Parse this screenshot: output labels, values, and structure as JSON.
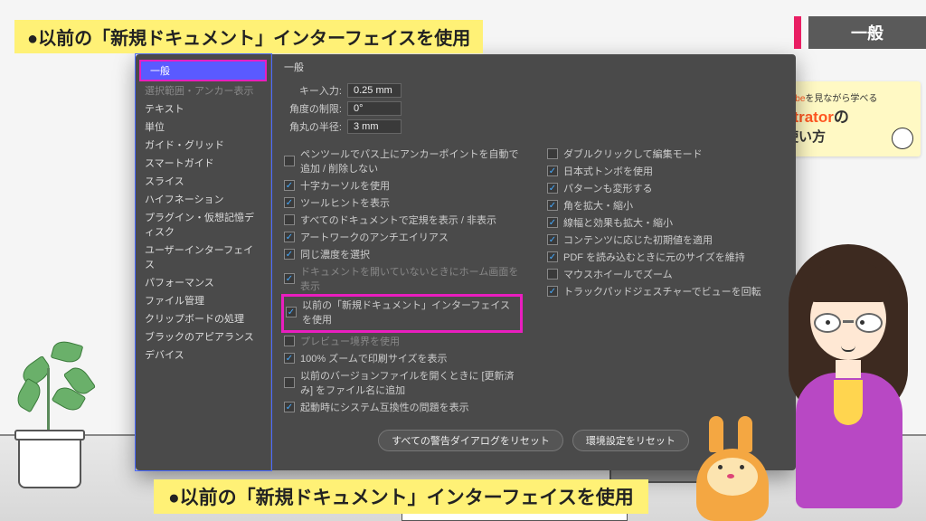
{
  "banner": {
    "top": "●以前の「新規ドキュメント」インターフェイスを使用",
    "bottom": "●以前の「新規ドキュメント」インターフェイスを使用"
  },
  "tab": {
    "label": "一般"
  },
  "promo": {
    "line1_a": "Tube",
    "line1_b": "を見ながら学べる",
    "line2_a": "strator",
    "line2_b": "の",
    "line3": "使い方"
  },
  "dialog": {
    "panel_title": "一般",
    "sidebar": [
      {
        "label": "一般",
        "selected": true
      },
      {
        "label": "選択範囲・アンカー表示",
        "dim": true
      },
      {
        "label": "テキスト"
      },
      {
        "label": "単位"
      },
      {
        "label": "ガイド・グリッド"
      },
      {
        "label": "スマートガイド"
      },
      {
        "label": "スライス"
      },
      {
        "label": "ハイフネーション"
      },
      {
        "label": "プラグイン・仮想記憶ディスク"
      },
      {
        "label": "ユーザーインターフェイス"
      },
      {
        "label": "パフォーマンス"
      },
      {
        "label": "ファイル管理"
      },
      {
        "label": "クリップボードの処理"
      },
      {
        "label": "ブラックのアピアランス"
      },
      {
        "label": "デバイス"
      }
    ],
    "fields": {
      "key_input": {
        "label": "キー入力:",
        "value": "0.25 mm"
      },
      "angle": {
        "label": "角度の制限:",
        "value": "0°"
      },
      "corner": {
        "label": "角丸の半径:",
        "value": "3 mm"
      }
    },
    "checks_left": [
      {
        "label": "ペンツールでパス上にアンカーポイントを自動で追加 / 削除しない",
        "checked": false
      },
      {
        "label": "十字カーソルを使用",
        "checked": true
      },
      {
        "label": "ツールヒントを表示",
        "checked": true
      },
      {
        "label": "すべてのドキュメントで定規を表示 / 非表示",
        "checked": false
      },
      {
        "label": "アートワークのアンチエイリアス",
        "checked": true
      },
      {
        "label": "同じ濃度を選択",
        "checked": true
      },
      {
        "label": "ドキュメントを開いていないときにホーム画面を表示",
        "checked": true,
        "disabled": true
      },
      {
        "label": "以前の「新規ドキュメント」インターフェイスを使用",
        "checked": true,
        "highlight": true
      },
      {
        "label": "プレビュー境界を使用",
        "checked": false,
        "disabled": true
      },
      {
        "label": "100% ズームで印刷サイズを表示",
        "checked": true
      },
      {
        "label": "以前のバージョンファイルを開くときに [更新済み] をファイル名に追加",
        "checked": false
      },
      {
        "label": "起動時にシステム互換性の問題を表示",
        "checked": true
      }
    ],
    "checks_right": [
      {
        "label": "ダブルクリックして編集モード",
        "checked": false
      },
      {
        "label": "日本式トンボを使用",
        "checked": true
      },
      {
        "label": "パターンも変形する",
        "checked": true
      },
      {
        "label": "角を拡大・縮小",
        "checked": true
      },
      {
        "label": "線幅と効果も拡大・縮小",
        "checked": true
      },
      {
        "label": "コンテンツに応じた初期値を適用",
        "checked": true
      },
      {
        "label": "PDF を読み込むときに元のサイズを維持",
        "checked": true
      },
      {
        "label": "マウスホイールでズーム",
        "checked": false
      },
      {
        "label": "トラックパッドジェスチャーでビューを回転",
        "checked": true
      }
    ],
    "buttons": {
      "reset_warnings": "すべての警告ダイアログをリセット",
      "reset_prefs": "環境設定をリセット"
    }
  }
}
